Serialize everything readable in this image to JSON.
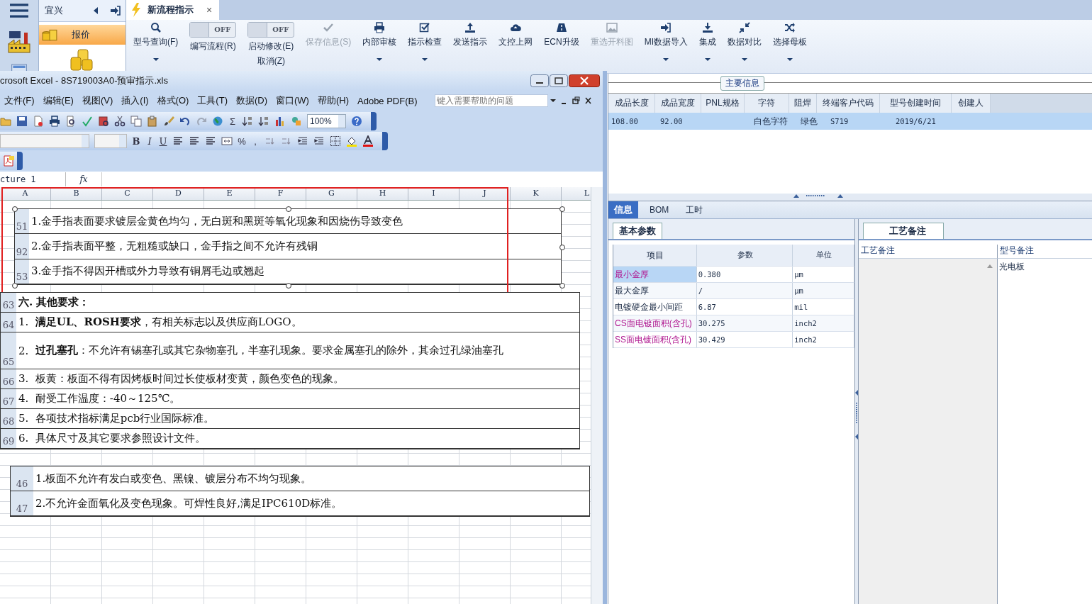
{
  "sidebar": {
    "title": "宜兴",
    "items": [
      {
        "label": "报价",
        "selected": true
      }
    ]
  },
  "tabs": [
    {
      "label": "新流程指示",
      "selected": true,
      "close": "×"
    }
  ],
  "ribbon": [
    {
      "kind": "button",
      "label": "型号查询(F)",
      "disabled": false,
      "dropdown": true
    },
    {
      "kind": "toggle",
      "state_text": "OFF",
      "on": false,
      "label": "编写流程(R)"
    },
    {
      "kind": "toggle",
      "state_text": "OFF",
      "on": false,
      "label": "启动修改(E)",
      "label2": "取消(Z)"
    },
    {
      "kind": "button",
      "label": "保存信息(S)",
      "disabled": true,
      "dropdown": false
    },
    {
      "kind": "button",
      "label": "内部审核",
      "disabled": false,
      "dropdown": true
    },
    {
      "kind": "button",
      "label": "指示检查",
      "disabled": false,
      "dropdown": true
    },
    {
      "kind": "button",
      "label": "发送指示",
      "disabled": false,
      "dropdown": false
    },
    {
      "kind": "button",
      "label": "文控上网",
      "disabled": false,
      "dropdown": false
    },
    {
      "kind": "button",
      "label": "ECN升级",
      "disabled": false,
      "dropdown": false
    },
    {
      "kind": "button",
      "label": "重选开料图",
      "disabled": true,
      "dropdown": false
    },
    {
      "kind": "button",
      "label": "MI数据导入",
      "disabled": false,
      "dropdown": true
    },
    {
      "kind": "button",
      "label": "集成",
      "disabled": false,
      "dropdown": true
    },
    {
      "kind": "button",
      "label": "数据对比",
      "disabled": false,
      "dropdown": true
    },
    {
      "kind": "button",
      "label": "选择母板",
      "disabled": false,
      "dropdown": true
    }
  ],
  "main_info": {
    "title": "主要信息",
    "columns": [
      "成品长度",
      "成品宽度",
      "PNL规格",
      "字符",
      "阻焊",
      "终端客户代码",
      "型号创建时间",
      "创建人"
    ],
    "rows": [
      {
        "selected": true,
        "cells": [
          "108.00",
          "92.00",
          "",
          "白色字符",
          "绿色",
          "S719",
          "2019/6/21",
          ""
        ]
      }
    ]
  },
  "detail_tabs": [
    {
      "label": "信息",
      "selected": true
    },
    {
      "label": "BOM",
      "selected": false
    },
    {
      "label": "工时",
      "selected": false
    }
  ],
  "params": {
    "tab": "基本参数",
    "columns": [
      "项目",
      "参数",
      "单位"
    ],
    "rows": [
      {
        "item": "最小金厚",
        "value": "0.380",
        "unit": "μm",
        "highlight": true,
        "selected": true
      },
      {
        "item": "最大金厚",
        "value": "/",
        "unit": "μm",
        "highlight": false,
        "selected": false
      },
      {
        "item": "电镀硬金最小间距",
        "value": "6.87",
        "unit": "mil",
        "highlight": false,
        "selected": false
      },
      {
        "item": "CS面电镀面积(含孔)",
        "value": "30.275",
        "unit": "inch2",
        "highlight": true,
        "selected": false
      },
      {
        "item": "SS面电镀面积(含孔)",
        "value": "30.429",
        "unit": "inch2",
        "highlight": true,
        "selected": false
      }
    ]
  },
  "notes": {
    "tab": "工艺备注",
    "columns": [
      "工艺备注",
      "型号备注"
    ],
    "model_note": "光电板"
  },
  "excel": {
    "title": "crosoft Excel - 8S719003A0-预审指示.xls",
    "menu": [
      "文件(F)",
      "编辑(E)",
      "视图(V)",
      "插入(I)",
      "格式(O)",
      "工具(T)",
      "数据(D)",
      "窗口(W)",
      "帮助(H)",
      "Adobe PDF(B)"
    ],
    "help_placeholder": "键入需要帮助的问题",
    "sum_symbol": "Σ",
    "zoom": "100%",
    "format_buttons": [
      "B",
      "I",
      "U"
    ],
    "number_buttons": [
      "%",
      ","
    ],
    "name_box": "cture 1",
    "formula_label": "fx",
    "columns": [
      "A",
      "B",
      "C",
      "D",
      "E",
      "F",
      "G",
      "H",
      "I",
      "J",
      "K",
      "L"
    ],
    "pictures": [
      {
        "selected": true,
        "rows": [
          {
            "label": "51",
            "text": "1.金手指表面要求镀层金黄色均匀，无白斑和黑斑等氧化现象和因烧伤导致变色"
          },
          {
            "label": "92",
            "text": "2.金手指表面平整，无粗糙或缺口，金手指之间不允许有残铜"
          },
          {
            "label": "53",
            "text": "3.金手指不得因开槽或外力导致有铜屑毛边或翘起"
          }
        ]
      },
      {
        "selected": false,
        "rows": [
          {
            "label": "63",
            "text": "六. 其他要求：",
            "heading": true
          },
          {
            "label": "64",
            "text": "1.  **满足UL、ROSH要求**，有相关标志以及供应商LOGO。"
          },
          {
            "label": "65",
            "text": "2.  **过孔塞孔**：不允许有锡塞孔或其它杂物塞孔，半塞孔现象。要求金属塞孔的除外，其余过孔绿油塞孔",
            "tall": true
          },
          {
            "label": "66",
            "text": "3.  板黄：板面不得有因烤板时间过长使板材变黄，颜色变色的现象。"
          },
          {
            "label": "67",
            "text": "4.  耐受工作温度：-40～125℃。"
          },
          {
            "label": "68",
            "text": "5.  各项技术指标满足pcb行业国际标准。"
          },
          {
            "label": "69",
            "text": "6.  具体尺寸及其它要求参照设计文件。"
          }
        ]
      },
      {
        "selected": false,
        "rows": [
          {
            "label": "46",
            "text": "1.板面不允许有发白或变色、黑镍、镀层分布不均匀现象。"
          },
          {
            "label": "47",
            "text": "2.不允许金面氧化及变色现象。可焊性良好,满足IPC610D标准。"
          }
        ]
      }
    ]
  }
}
